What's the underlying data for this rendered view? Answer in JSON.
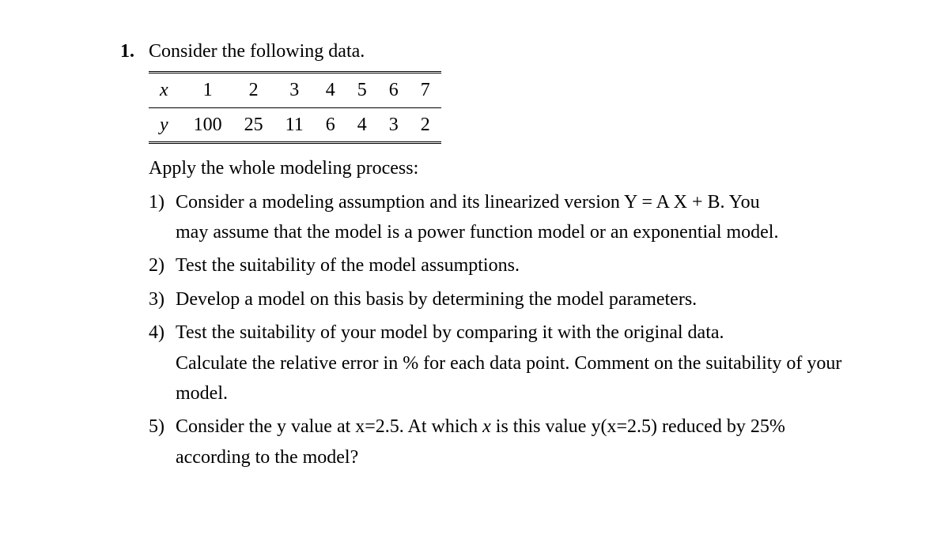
{
  "problem": {
    "number": "1.",
    "intro": "Consider the following data.",
    "table": {
      "x_label": "x",
      "y_label": "y",
      "x": [
        "1",
        "2",
        "3",
        "4",
        "5",
        "6",
        "7"
      ],
      "y": [
        "100",
        "25",
        "11",
        "6",
        "4",
        "3",
        "2"
      ]
    },
    "instruction": "Apply the whole modeling process:",
    "steps": [
      {
        "num": "1)",
        "text_a": "Consider a modeling assumption and its linearized version Y = A X + B. You",
        "text_b": "may assume that the model is a power function model or an exponential model."
      },
      {
        "num": "2)",
        "text_a": "Test the suitability of the model assumptions."
      },
      {
        "num": "3)",
        "text_a": "Develop a model on this basis by determining the model parameters."
      },
      {
        "num": "4)",
        "text_a": "Test the suitability of your model by comparing it with the original data.",
        "text_b": "Calculate the relative error in % for each data point. Comment on the suitability of your model."
      },
      {
        "num": "5)",
        "text_a_pre": "Consider the y value at x=2.5. At which ",
        "text_a_ital": "x",
        "text_a_post": " is this value y(x=2.5) reduced by 25%",
        "text_b": "according to the model?"
      }
    ]
  }
}
